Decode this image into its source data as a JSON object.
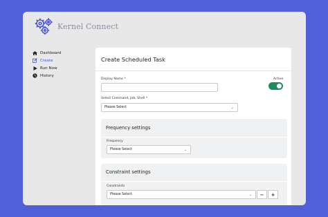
{
  "app": {
    "name": "Kernel Connect"
  },
  "nav": {
    "items": [
      {
        "label": "Dashboard",
        "icon": "home-icon",
        "active": false
      },
      {
        "label": "Create",
        "icon": "edit-icon",
        "active": true
      },
      {
        "label": "Run Now",
        "icon": "play-icon",
        "active": false
      },
      {
        "label": "History",
        "icon": "clock-icon",
        "active": false
      }
    ]
  },
  "form": {
    "title": "Create Scheduled Task",
    "display_name_label": "Display Name *",
    "display_name_value": "",
    "active_label": "Active",
    "active_on": true,
    "command_label": "Select Command, Job, Shell *",
    "command_value": "Please Select",
    "frequency_section": {
      "title": "Frequency settings",
      "label": "Frequency",
      "value": "Please Select"
    },
    "constraint_section": {
      "title": "Constraint settings",
      "label": "Constraints",
      "value": "Please Select",
      "minus_label": "−",
      "plus_label": "+"
    }
  },
  "colors": {
    "background": "#5060d8",
    "accent": "#4a55d8",
    "toggle_on": "#1f8a5b"
  }
}
